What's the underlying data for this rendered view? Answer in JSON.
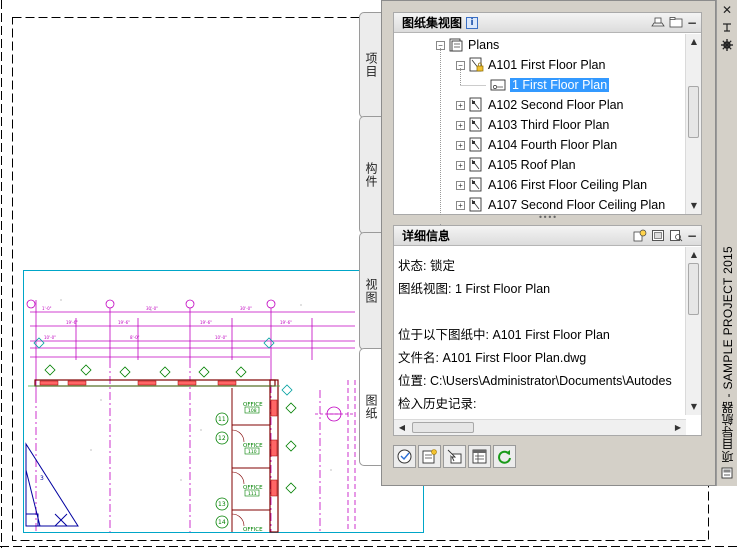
{
  "palette": {
    "title": "项目导航器 - SAMPLE PROJECT 2015",
    "tabs": [
      {
        "label": "项目"
      },
      {
        "label": "构件"
      },
      {
        "label": "视图"
      },
      {
        "label": "图纸"
      }
    ],
    "sheet_set_view": {
      "header": "图纸集视图",
      "info_badge": "i",
      "tree": [
        {
          "label": "Plans",
          "expander": "⊟",
          "icon": "folder-sheets-icon"
        },
        {
          "label": "A101 First Floor Plan",
          "expander": "⊟",
          "icon": "locked-sheet-icon"
        },
        {
          "label": "1 First Floor Plan",
          "expander": "",
          "icon": "sheet-view-icon",
          "selected": true
        },
        {
          "label": "A102 Second Floor Plan",
          "expander": "⊞",
          "icon": "sheet-icon"
        },
        {
          "label": "A103 Third Floor Plan",
          "expander": "⊞",
          "icon": "sheet-icon"
        },
        {
          "label": "A104 Fourth Floor Plan",
          "expander": "⊞",
          "icon": "sheet-icon"
        },
        {
          "label": "A105 Roof Plan",
          "expander": "⊞",
          "icon": "sheet-icon"
        },
        {
          "label": "A106 First Floor Ceiling Plan",
          "expander": "⊞",
          "icon": "sheet-icon"
        },
        {
          "label": "A107 Second Floor Ceiling Plan",
          "expander": "⊞",
          "icon": "sheet-icon"
        }
      ]
    },
    "details": {
      "header": "详细信息",
      "lines": [
        "状态: 锁定",
        "图纸视图: 1 First Floor Plan",
        "",
        "位于以下图纸中: A101 First Floor Plan",
        "文件名: A101 First Floor Plan.dwg",
        "位置: C:\\Users\\Administrator\\Documents\\Autodes",
        "检入历史记录:"
      ]
    },
    "window_buttons": {
      "close": "✕"
    },
    "bottom_tools": [
      "open-sheet-icon",
      "new-sheet-icon",
      "select-icon",
      "sheet-list-icon",
      "refresh-icon"
    ]
  },
  "drawing": {
    "room_labels": [
      "OFFICE",
      "OFFICE",
      "OFFICE",
      "OFFICE"
    ],
    "room_numbers": [
      "108",
      "110",
      "111",
      ""
    ],
    "grid_bubbles": [
      "11",
      "12",
      "13",
      "14"
    ],
    "colors": {
      "grid": "#ff00ff",
      "walls": "#800000",
      "dim": "#c000c0",
      "accent": "#00a0a0",
      "tag": "#008000"
    }
  }
}
